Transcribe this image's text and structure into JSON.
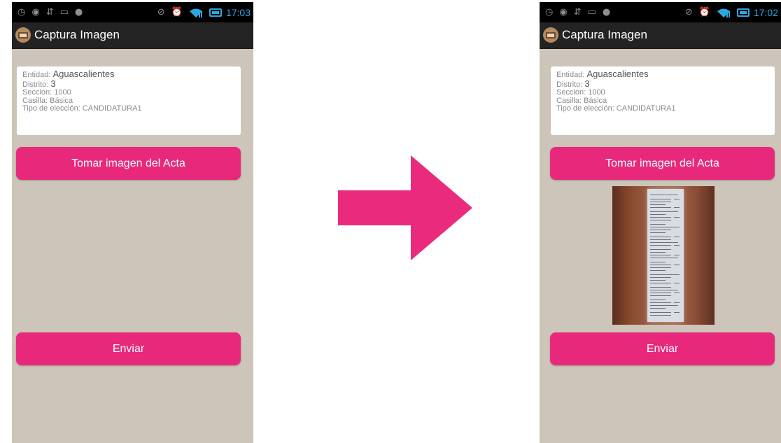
{
  "screens": [
    {
      "id": "before",
      "status_time": "17:03",
      "app_title": "Captura Imagen",
      "info": {
        "entidad_label": "Entidad:",
        "entidad_value": "Aguascalientes",
        "distrito_label": "Distrito:",
        "distrito_value": "3",
        "seccion": "Seccion: 1000",
        "casilla": "Casilla: Básica",
        "tipo": "Tipo de elección: CANDIDATURA1"
      },
      "capture_button": "Tomar imagen del Acta",
      "send_button": "Enviar",
      "has_photo": false
    },
    {
      "id": "after",
      "status_time": "17:02",
      "app_title": "Captura Imagen",
      "info": {
        "entidad_label": "Entidad:",
        "entidad_value": "Aguascalientes",
        "distrito_label": "Distrito:",
        "distrito_value": "3",
        "seccion": "Seccion: 1000",
        "casilla": "Casilla: Básica",
        "tipo": "Tipo de elección: CANDIDATURA1"
      },
      "capture_button": "Tomar imagen del Acta",
      "send_button": "Enviar",
      "has_photo": true
    }
  ],
  "status_icons": [
    "whatsapp-icon",
    "messenger-icon",
    "usb-icon",
    "sms-icon",
    "game-icon",
    "mute-icon",
    "alarm-icon",
    "wifi-icon",
    "signal-icon",
    "battery-icon"
  ],
  "colors": {
    "accent": "#e8297b",
    "status_blue": "#2ea7e0",
    "background": "#cdc5b9",
    "action_bar": "#232323"
  }
}
